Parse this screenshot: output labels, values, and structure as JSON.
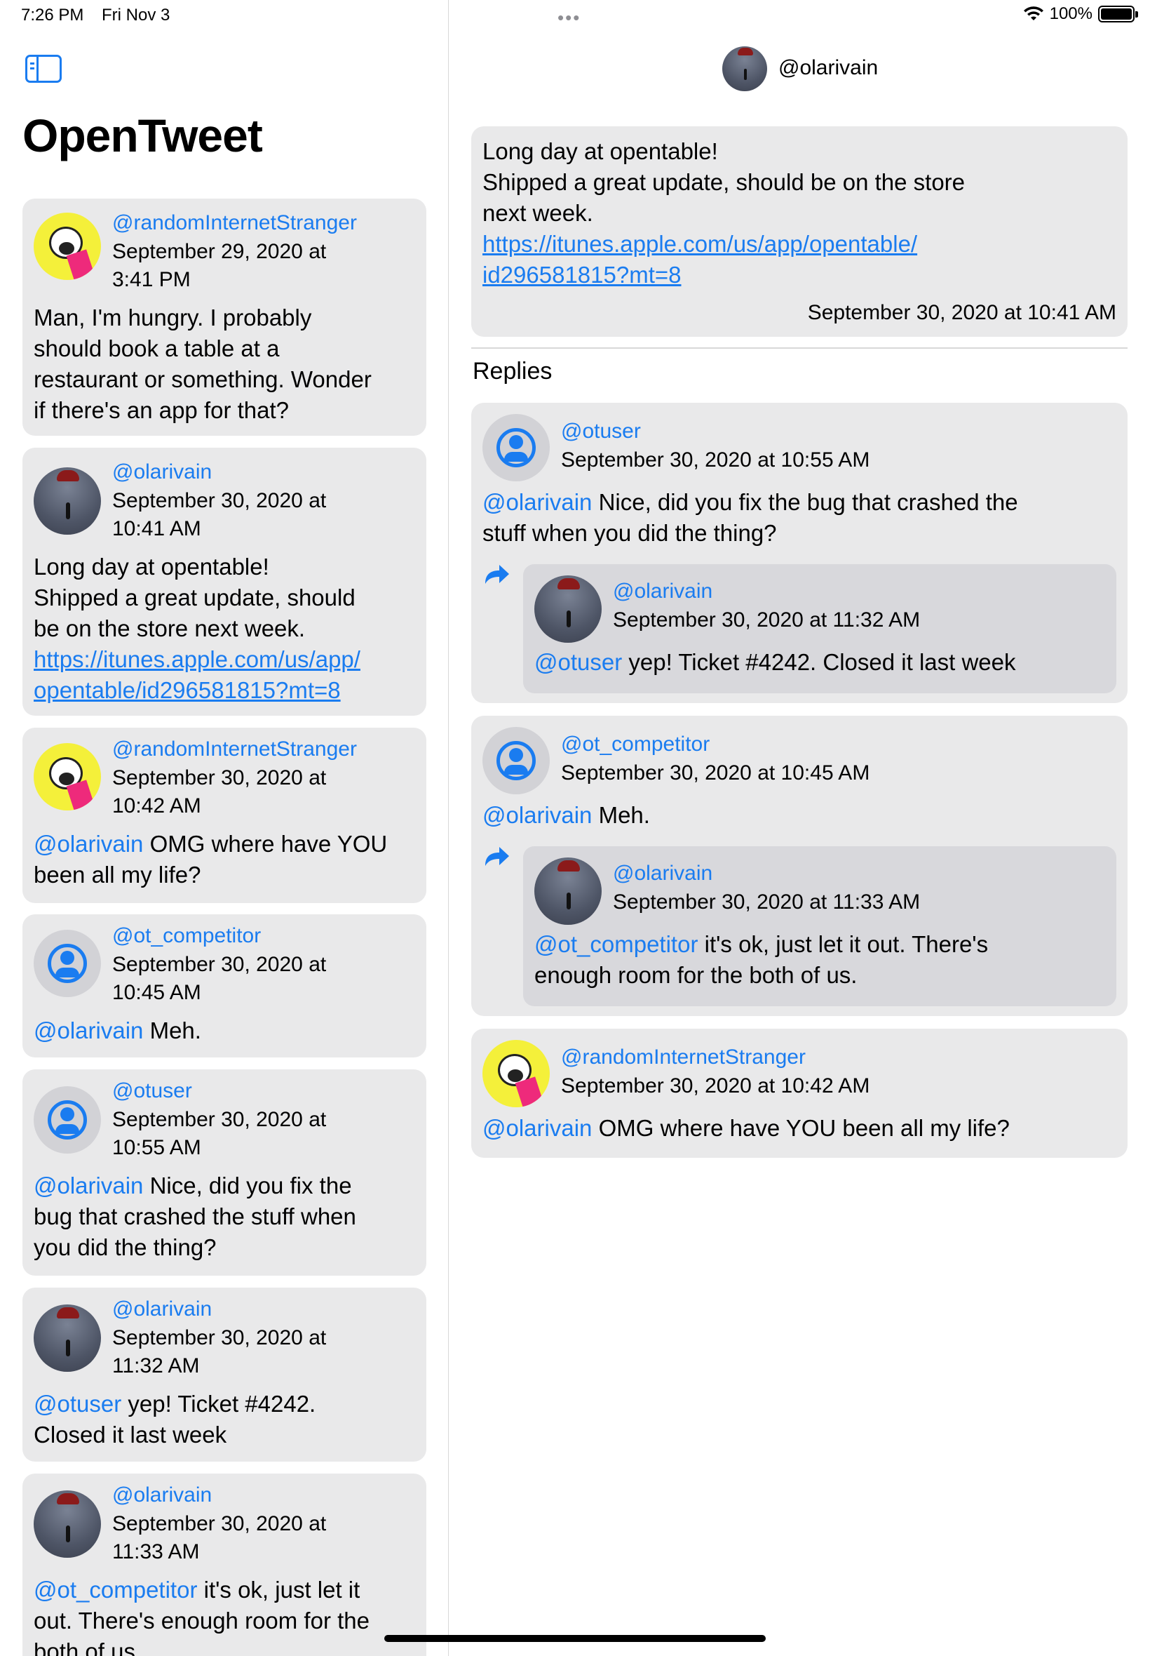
{
  "status_bar": {
    "time": "7:26 PM",
    "date": "Fri Nov 3",
    "dots": "•••",
    "battery": "100%",
    "battery_level": 1.0
  },
  "app": {
    "title": "OpenTweet"
  },
  "colors": {
    "accent": "#1a7cf0",
    "card": "#e9e9ea",
    "nested_card": "#d8d8dc"
  },
  "feed": [
    {
      "avatar": "meme-avatar",
      "handle": "@randomInternetStranger",
      "date_l1": "September 29, 2020 at",
      "date_l2": "3:41 PM",
      "lines": [
        "Man, I'm hungry. I probably",
        "should book a table at a",
        "restaurant or something. Wonder",
        "if there's an app for that?"
      ]
    },
    {
      "avatar": "photo-avatar",
      "handle": "@olarivain",
      "date_l1": "September 30, 2020 at",
      "date_l2": "10:41 AM",
      "lines": [
        "Long day at opentable!",
        "Shipped a great update, should",
        "be on the store next week."
      ],
      "link_lines": [
        "https://itunes.apple.com/us/app/",
        "opentable/id296581815?mt=8"
      ]
    },
    {
      "avatar": "meme-avatar",
      "handle": "@randomInternetStranger",
      "date_l1": "September 30, 2020 at",
      "date_l2": "10:42 AM",
      "mention": "@olarivain",
      "lines": [
        " OMG where have YOU",
        "been all my life?"
      ]
    },
    {
      "avatar": "user-avatar",
      "handle": "@ot_competitor",
      "date_l1": "September 30, 2020 at",
      "date_l2": "10:45 AM",
      "mention": "@olarivain",
      "lines": [
        " Meh."
      ]
    },
    {
      "avatar": "user-avatar",
      "handle": "@otuser",
      "date_l1": "September 30, 2020 at",
      "date_l2": "10:55 AM",
      "mention": "@olarivain",
      "lines": [
        " Nice, did you fix the",
        "bug that crashed the stuff when",
        "you did the thing?"
      ]
    },
    {
      "avatar": "photo-avatar",
      "handle": "@olarivain",
      "date_l1": "September 30, 2020 at",
      "date_l2": "11:32 AM",
      "mention": "@otuser",
      "lines": [
        " yep! Ticket #4242.",
        "Closed it last week"
      ]
    },
    {
      "avatar": "photo-avatar",
      "handle": "@olarivain",
      "date_l1": "September 30, 2020 at",
      "date_l2": "11:33 AM",
      "mention": "@ot_competitor",
      "lines": [
        " it's ok, just let it",
        "out. There's enough room for the",
        "both of us."
      ]
    }
  ],
  "detail": {
    "header_handle": "@olarivain",
    "main": {
      "lines": [
        "Long day at opentable!",
        "Shipped a great update, should be on the store",
        "next week."
      ],
      "link_lines": [
        "https://itunes.apple.com/us/app/opentable/",
        "id296581815?mt=8"
      ],
      "date": "September 30, 2020 at 10:41 AM"
    },
    "replies_title": "Replies",
    "replies": [
      {
        "handle": "@otuser",
        "date": "September 30, 2020 at 10:55 AM",
        "mention": "@olarivain",
        "lines": [
          " Nice, did you fix the bug that crashed the",
          "stuff when you did the thing?"
        ],
        "nested": {
          "handle": "@olarivain",
          "date": "September 30, 2020 at 11:32 AM",
          "mention": "@otuser",
          "lines": [
            " yep! Ticket #4242. Closed it last week"
          ]
        }
      },
      {
        "handle": "@ot_competitor",
        "date": "September 30, 2020 at 10:45 AM",
        "mention": "@olarivain",
        "lines": [
          " Meh."
        ],
        "nested": {
          "handle": "@olarivain",
          "date": "September 30, 2020 at 11:33 AM",
          "mention": "@ot_competitor",
          "lines": [
            " it's ok, just let it out. There's",
            "enough room for the both of us."
          ]
        }
      },
      {
        "handle": "@randomInternetStranger",
        "date": "September 30, 2020 at 10:42 AM",
        "mention": "@olarivain",
        "lines": [
          " OMG where have YOU been all my life?"
        ]
      }
    ]
  }
}
